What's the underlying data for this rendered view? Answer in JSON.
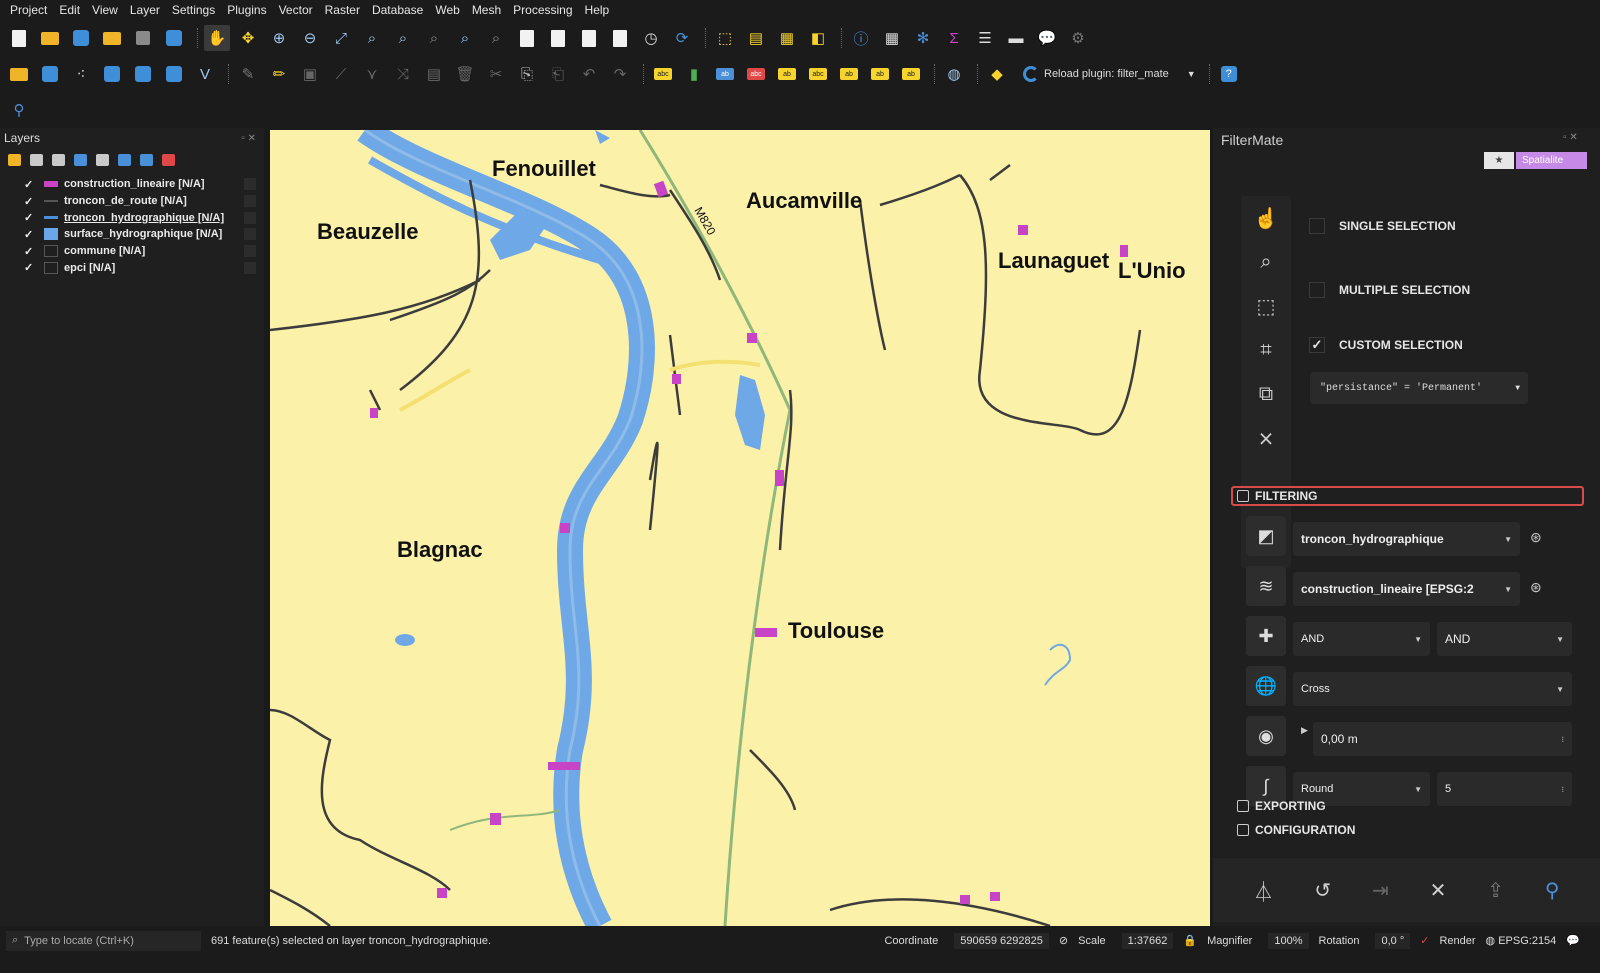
{
  "menu": [
    "Project",
    "Edit",
    "View",
    "Layer",
    "Settings",
    "Plugins",
    "Vector",
    "Raster",
    "Database",
    "Web",
    "Mesh",
    "Processing",
    "Help"
  ],
  "toolbar": {
    "reload_label": "Reload plugin: filter_mate"
  },
  "layers_panel": {
    "title": "Layers",
    "items": [
      {
        "label": "construction_lineaire [N/A]",
        "checked": "✓",
        "color": "#c744c7"
      },
      {
        "label": "troncon_de_route [N/A]",
        "checked": "✓",
        "color": "#3c3c3c"
      },
      {
        "label": "troncon_hydrographique [N/A]",
        "checked": "✓",
        "color": "#4a90d9"
      },
      {
        "label": "surface_hydrographique [N/A]",
        "checked": "✓",
        "color": "#6aa6e8"
      },
      {
        "label": "commune [N/A]",
        "checked": "✓",
        "color": "#2a2a2a"
      },
      {
        "label": "epci [N/A]",
        "checked": "✓",
        "color": "#2a2a2a"
      }
    ]
  },
  "map": {
    "places": [
      "Fenouillet",
      "Aucamville",
      "Beauzelle",
      "Launaguet",
      "L'Unio",
      "Blagnac",
      "Toulouse"
    ],
    "road_label": "M820"
  },
  "filtermate": {
    "title": "FilterMate",
    "star": "★",
    "backend": "Spatialite",
    "single_selection": "SINGLE SELECTION",
    "multiple_selection": "MULTIPLE SELECTION",
    "custom_selection": "CUSTOM SELECTION",
    "expression": "\"persistance\" = 'Permanent'",
    "filtering": "FILTERING",
    "source_layer": "troncon_hydrographique",
    "target_layer": "construction_lineaire [EPSG:2",
    "op1": "AND",
    "op2": "AND",
    "predicate": "Cross",
    "buffer": "0,00 m",
    "buffer_type": "Round",
    "segments": "5",
    "exporting": "EXPORTING",
    "configuration": "CONFIGURATION"
  },
  "status": {
    "locate_placeholder": "Type to locate (Ctrl+K)",
    "message": "691 feature(s) selected on layer troncon_hydrographique.",
    "coordinate_label": "Coordinate",
    "coordinate": "590659  6292825",
    "scale_label": "Scale",
    "scale": "1:37662",
    "magnifier_label": "Magnifier",
    "magnifier": "100%",
    "rotation_label": "Rotation",
    "rotation": "0,0 °",
    "render": "Render",
    "crs": "EPSG:2154"
  }
}
